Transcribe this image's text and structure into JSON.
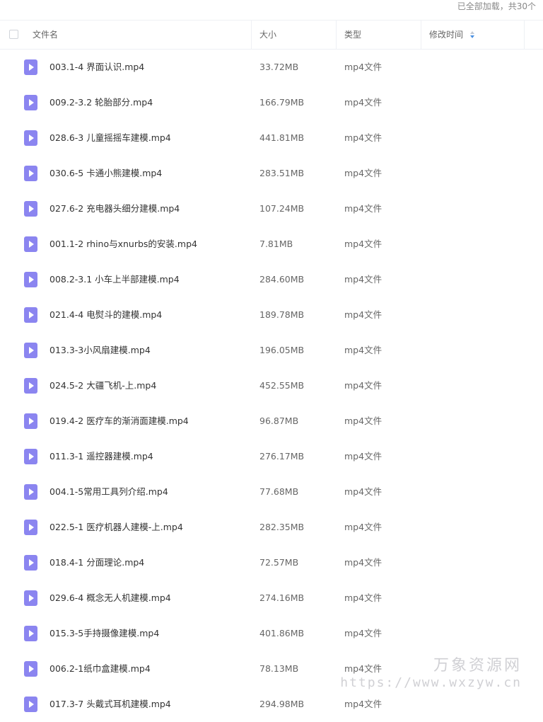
{
  "status_text": "已全部加载，共30个",
  "columns": {
    "name": "文件名",
    "size": "大小",
    "type": "类型",
    "modified": "修改时间"
  },
  "files": [
    {
      "name": "003.1-4 界面认识.mp4",
      "size": "33.72MB",
      "type": "mp4文件"
    },
    {
      "name": "009.2-3.2 轮胎部分.mp4",
      "size": "166.79MB",
      "type": "mp4文件"
    },
    {
      "name": "028.6-3 儿童摇摇车建模.mp4",
      "size": "441.81MB",
      "type": "mp4文件"
    },
    {
      "name": "030.6-5 卡通小熊建模.mp4",
      "size": "283.51MB",
      "type": "mp4文件"
    },
    {
      "name": "027.6-2 充电器头细分建模.mp4",
      "size": "107.24MB",
      "type": "mp4文件"
    },
    {
      "name": "001.1-2 rhino与xnurbs的安装.mp4",
      "size": "7.81MB",
      "type": "mp4文件"
    },
    {
      "name": "008.2-3.1 小车上半部建模.mp4",
      "size": "284.60MB",
      "type": "mp4文件"
    },
    {
      "name": "021.4-4 电熨斗的建模.mp4",
      "size": "189.78MB",
      "type": "mp4文件"
    },
    {
      "name": "013.3-3小风扇建模.mp4",
      "size": "196.05MB",
      "type": "mp4文件"
    },
    {
      "name": "024.5-2 大疆飞机-上.mp4",
      "size": "452.55MB",
      "type": "mp4文件"
    },
    {
      "name": "019.4-2 医疗车的渐消面建模.mp4",
      "size": "96.87MB",
      "type": "mp4文件"
    },
    {
      "name": "011.3-1 遥控器建模.mp4",
      "size": "276.17MB",
      "type": "mp4文件"
    },
    {
      "name": "004.1-5常用工具列介绍.mp4",
      "size": "77.68MB",
      "type": "mp4文件"
    },
    {
      "name": "022.5-1 医疗机器人建模-上.mp4",
      "size": "282.35MB",
      "type": "mp4文件"
    },
    {
      "name": "018.4-1 分面理论.mp4",
      "size": "72.57MB",
      "type": "mp4文件"
    },
    {
      "name": "029.6-4 概念无人机建模.mp4",
      "size": "274.16MB",
      "type": "mp4文件"
    },
    {
      "name": "015.3-5手持摄像建模.mp4",
      "size": "401.86MB",
      "type": "mp4文件"
    },
    {
      "name": "006.2-1纸巾盒建模.mp4",
      "size": "78.13MB",
      "type": "mp4文件"
    },
    {
      "name": "017.3-7 头戴式耳机建模.mp4",
      "size": "294.98MB",
      "type": "mp4文件"
    }
  ],
  "watermark": {
    "line1": "万象资源网",
    "line2": "https://www.wxzyw.cn"
  }
}
